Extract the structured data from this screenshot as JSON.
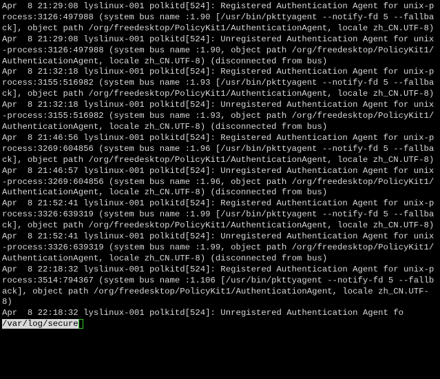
{
  "log": {
    "entries": [
      "Apr  8 21:29:08 lyslinux-001 polkitd[524]: Registered Authentication Agent for unix-process:3126:497988 (system bus name :1.90 [/usr/bin/pkttyagent --notify-fd 5 --fallback], object path /org/freedesktop/PolicyKit1/AuthenticationAgent, locale zh_CN.UTF-8)",
      "Apr  8 21:29:08 lyslinux-001 polkitd[524]: Unregistered Authentication Agent for unix-process:3126:497988 (system bus name :1.90, object path /org/freedesktop/PolicyKit1/AuthenticationAgent, locale zh_CN.UTF-8) (disconnected from bus)",
      "Apr  8 21:32:18 lyslinux-001 polkitd[524]: Registered Authentication Agent for unix-process:3155:516982 (system bus name :1.93 [/usr/bin/pkttyagent --notify-fd 5 --fallback], object path /org/freedesktop/PolicyKit1/AuthenticationAgent, locale zh_CN.UTF-8)",
      "Apr  8 21:32:18 lyslinux-001 polkitd[524]: Unregistered Authentication Agent for unix-process:3155:516982 (system bus name :1.93, object path /org/freedesktop/PolicyKit1/AuthenticationAgent, locale zh_CN.UTF-8) (disconnected from bus)",
      "Apr  8 21:46:56 lyslinux-001 polkitd[524]: Registered Authentication Agent for unix-process:3269:604856 (system bus name :1.96 [/usr/bin/pkttyagent --notify-fd 5 --fallback], object path /org/freedesktop/PolicyKit1/AuthenticationAgent, locale zh_CN.UTF-8)",
      "Apr  8 21:46:57 lyslinux-001 polkitd[524]: Unregistered Authentication Agent for unix-process:3269:604856 (system bus name :1.96, object path /org/freedesktop/PolicyKit1/AuthenticationAgent, locale zh_CN.UTF-8) (disconnected from bus)",
      "Apr  8 21:52:41 lyslinux-001 polkitd[524]: Registered Authentication Agent for unix-process:3326:639319 (system bus name :1.99 [/usr/bin/pkttyagent --notify-fd 5 --fallback], object path /org/freedesktop/PolicyKit1/AuthenticationAgent, locale zh_CN.UTF-8)",
      "Apr  8 21:52:41 lyslinux-001 polkitd[524]: Unregistered Authentication Agent for unix-process:3326:639319 (system bus name :1.99, object path /org/freedesktop/PolicyKit1/AuthenticationAgent, locale zh_CN.UTF-8) (disconnected from bus)",
      "Apr  8 22:18:32 lyslinux-001 polkitd[524]: Registered Authentication Agent for unix-process:3514:794367 (system bus name :1.106 [/usr/bin/pkttyagent --notify-fd 5 --fallback], object path /org/freedesktop/PolicyKit1/AuthenticationAgent, locale zh_CN.UTF-8)",
      "Apr  8 22:18:32 lyslinux-001 polkitd[524]: Unregistered Authentication Agent fo"
    ]
  },
  "status": {
    "file": "/var/log/secure"
  }
}
